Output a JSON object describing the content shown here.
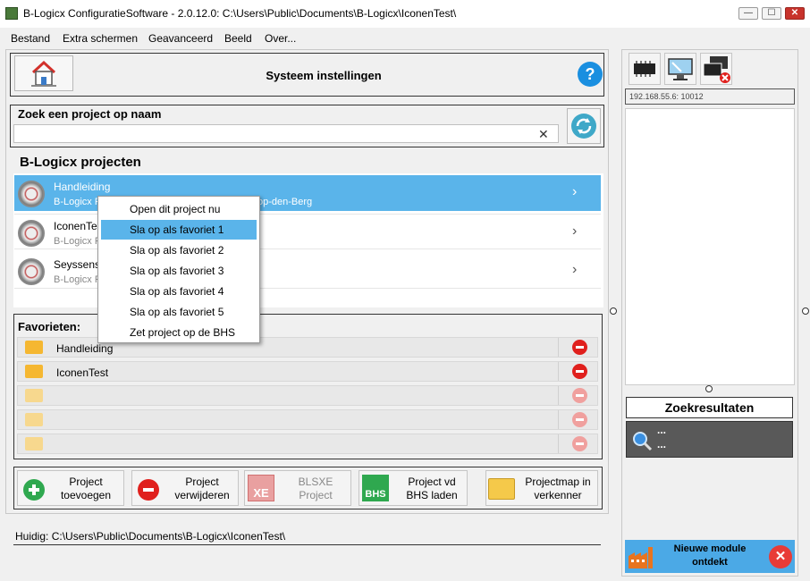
{
  "window": {
    "title": "B-Logicx ConfiguratieSoftware - 2.0.12.0: C:\\Users\\Public\\Documents\\B-Logicx\\IconenTest\\",
    "controls": {
      "minimize": "—",
      "maximize": "☐",
      "close": "✕"
    }
  },
  "menu": {
    "items": [
      "Bestand",
      "Extra schermen",
      "Geavanceerd",
      "Beeld",
      "Over..."
    ]
  },
  "header": {
    "title": "Systeem instellingen",
    "help": "?"
  },
  "search": {
    "label": "Zoek een project op naam",
    "value": "",
    "clear_glyph": "✕"
  },
  "projects": {
    "heading": "B-Logicx projecten",
    "items": [
      {
        "name": "Handleiding",
        "sub_left": "B-Logicx F",
        "sub_right": "op-den-Berg",
        "selected": true
      },
      {
        "name": "IconenTes",
        "sub_left": "B-Logicx F",
        "selected": false
      },
      {
        "name": "Seyssens",
        "sub_left": "B-Logicx F",
        "selected": false
      }
    ],
    "chevron": "›"
  },
  "context_menu": {
    "items": [
      "Open dit project nu",
      "Sla op als favoriet 1",
      "Sla op als favoriet 2",
      "Sla op als favoriet 3",
      "Sla op als favoriet 4",
      "Sla op als favoriet 5",
      "Zet project op de BHS"
    ],
    "highlighted_index": 1
  },
  "favorites": {
    "label": "Favorieten:",
    "items": [
      {
        "name": "Handleiding"
      },
      {
        "name": "IconenTest"
      },
      {
        "name": ""
      },
      {
        "name": ""
      },
      {
        "name": ""
      }
    ]
  },
  "actions": {
    "add": "Project\ntoevoegen",
    "remove": "Project\nverwijderen",
    "blsxe": "BLSXE\nProject",
    "bhs": "Project vd\nBHS laden",
    "folder": "Projectmap in\nverkenner",
    "blsxe_icon_text": "XE",
    "bhs_icon_text": "BHS"
  },
  "status": {
    "current": "Huidig: C:\\Users\\Public\\Documents\\B-Logicx\\IconenTest\\"
  },
  "right_panel": {
    "ip": "192.168.55.6: 10012",
    "zoek_label": "Zoekresultaten",
    "zoek_line1": "...",
    "zoek_line2": "...",
    "new_module": "Nieuwe module\nontdekt",
    "new_module_close": "✕"
  },
  "colors": {
    "selection": "#5ab4ea",
    "help_blue": "#1a8fe0",
    "delete_red": "#e0201d",
    "folder_yellow": "#f5b731",
    "add_green": "#2fa84f"
  }
}
